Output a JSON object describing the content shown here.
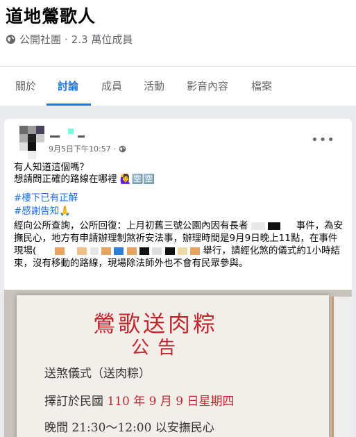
{
  "group": {
    "title": "道地鶯歌人",
    "privacy": "公開社團",
    "separator": "·",
    "members": "2.3 萬位成員"
  },
  "tabs": [
    "關於",
    "討論",
    "成員",
    "活動",
    "影音內容",
    "檔案"
  ],
  "active_tab": "討論",
  "post": {
    "timestamp": "9月5日下午10:57",
    "dot": "·",
    "more": "•••",
    "line1": "有人知道這個嗎？",
    "line2": "想請問正確的路線在哪裡 🙋‍♀️🈳🈳",
    "tag1": "#樓下已有正解",
    "tag2": "#感謝告知🙏",
    "para_a": "經向公所查詢，公所回復：上月初舊三號公園內因有長者",
    "para_b": "事件，為安撫民心，地方有申請辦理制煞祈安法事，辦理時間是9月9日晚上11點，在事件現場(",
    "para_c": "舉行，請經化煞的儀式約1小時結束，沒有移動的路線，現場除法師外也不會有民眾參與。"
  },
  "photo": {
    "title": "鶯歌送肉粽",
    "subtitle": "公告",
    "line1": "送煞儀式（送肉粽）",
    "line2_label": "擇訂於民國",
    "line2_date": "110 年 9 月 9 日星期四",
    "line3": "晚間 21:30～12:00 以安撫民心"
  }
}
